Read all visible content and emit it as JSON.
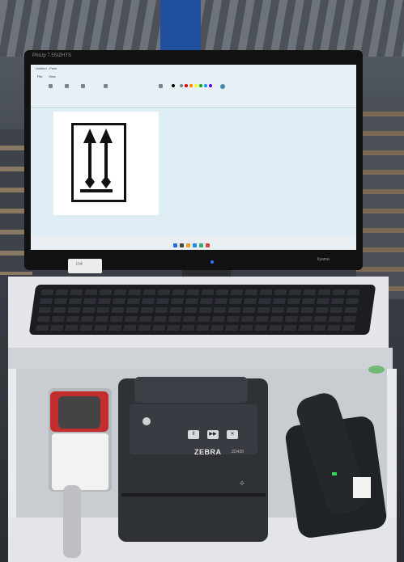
{
  "monitor": {
    "brand": "PhiLlp 7.5SIZHTS",
    "logo": "Iiyama",
    "bezel_sticker": "in4"
  },
  "paint_app": {
    "window_title": "Untitled - Paint",
    "tabs": [
      "File",
      "View"
    ],
    "canvas_content": "this-way-up-arrows-sign"
  },
  "printer": {
    "brand": "ZEBRA",
    "model": "ZD420",
    "buttons": [
      "II",
      "▶▶",
      "✕"
    ]
  },
  "colors": {
    "screen": "#dfeef4",
    "printer_body": "#2e3136",
    "dispenser_red": "#c22e2e",
    "scanner_led": "#37d65a",
    "monitor_led": "#2a7bff"
  }
}
